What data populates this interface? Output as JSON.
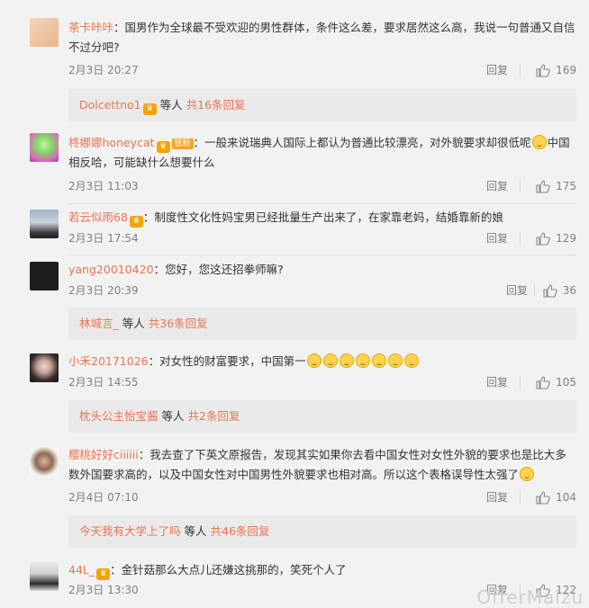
{
  "comments": [
    {
      "name": "茶卡咔咔",
      "sep": "：",
      "body": "国男作为全球最不受欢迎的男性群体，条件这么差，要求居然这么高，我说一句普通又自信不过分吧?",
      "date": "2月3日 20:27",
      "reply_label": "回复",
      "likes": "169"
    },
    {
      "name": "柊娜娜honeycat",
      "badge": "铁粉",
      "sep": "：",
      "body": "一般来说瑞典人国际上都认为普通比较漂亮，对外貌要求却很低呢",
      "body2": "中国相反哈，可能缺什么想要什么",
      "date": "2月3日 11:03",
      "reply_label": "回复",
      "likes": "175"
    },
    {
      "name": "若云似雨68",
      "sep": "：",
      "body": "制度性文化性妈宝男已经批量生产出来了，在家靠老妈，结婚靠新的娘",
      "date": "2月3日 17:54",
      "reply_label": "回复",
      "likes": "129"
    },
    {
      "name": "yang20010420",
      "sep": "：",
      "body": "您好，您这还招拳师嘛?",
      "date": "2月3日 20:39",
      "reply_label": "回复",
      "likes": "36"
    },
    {
      "name": "小禾20171026",
      "sep": "：",
      "body": "对女性的财富要求，中国第一",
      "date": "2月3日 14:55",
      "reply_label": "回复",
      "likes": "105"
    },
    {
      "name": "樱桃好好ciiiiii",
      "sep": "：",
      "body": "我去查了下英文原报告，发现其实如果你去看中国女性对女性外貌的要求也是比大多数外国要求高的，以及中国女性对中国男性外貌要求也相对高。所以这个表格误导性太强了",
      "date": "2月4日 07:10",
      "reply_label": "回复",
      "likes": "104"
    },
    {
      "name": "44L_",
      "sep": "：",
      "body": "金针菇那么大点儿还嫌这挑那的，笑死个人了",
      "date": "2月3日 13:30",
      "reply_label": "回复",
      "likes": "122"
    }
  ],
  "subreplies": [
    {
      "name": "Dolcettno1",
      "mid": "等人",
      "more": "共16条回复"
    },
    {
      "name": "林城言_",
      "mid": "等人",
      "more": "共36条回复"
    },
    {
      "name": "枕头公主怡宝酱",
      "mid": "等人",
      "more": "共2条回复"
    },
    {
      "name": "今天我有大学上了吗",
      "mid": "等人",
      "more": "共46条回复"
    }
  ],
  "watermark": "OfferMaizu",
  "colors": {
    "name": "#eb7350",
    "meta": "#808080",
    "bg": "#f2f2f2",
    "subreply_bg": "#eaeaea"
  }
}
